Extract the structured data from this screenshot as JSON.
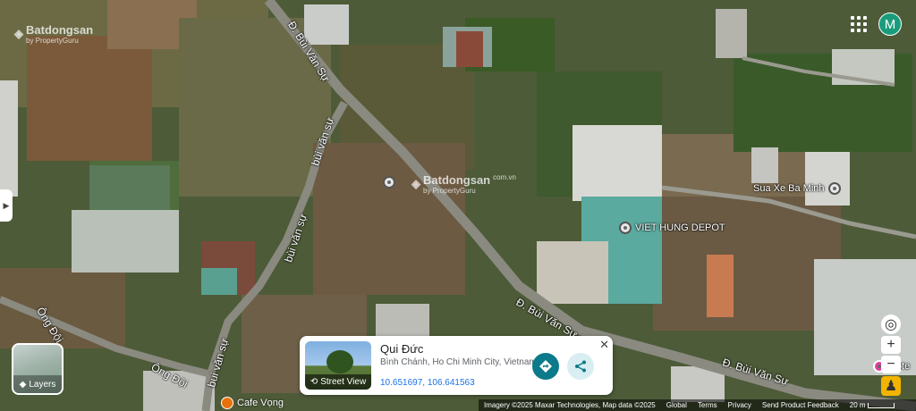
{
  "watermarks": [
    {
      "brand": "Batdongsan",
      "tagline": "by PropertyGuru",
      "domain": "com.vn"
    },
    {
      "brand": "Batdongsan",
      "tagline": "by PropertyGuru",
      "domain": "com.vn"
    }
  ],
  "roads": {
    "bui_van_su_1": "Đ. Bùi Văn Sự",
    "bui_van_su_2": "bùi văn sự",
    "bui_van_su_3": "bùi văn sự",
    "bui_van_su_4": "bui văn sự",
    "bui_van_su_5": "Đ. Bùi Văn Sự",
    "bui_van_su_6": "Đ. Bùi Văn Sự",
    "ong_doi_1": "Ông Đội",
    "ong_doi_2": "Ông Đội"
  },
  "places": {
    "sua_xe": "Sua Xe Ba Minh",
    "viet_hung": "VIET HUNG DEPOT",
    "cafe": "Cafe Vọng",
    "partial_right": "Hote"
  },
  "account": {
    "initial": "M",
    "color": "#1a9c7c"
  },
  "layers": {
    "label": "Layers"
  },
  "card": {
    "title": "Qui Đức",
    "address": "Bình Chánh, Ho Chi Minh City, Vietnam",
    "coordinates": "10.651697, 106.641563",
    "street_view_label": "Street View",
    "close": "✕",
    "directions_icon": "directions-icon",
    "share_icon": "share-icon",
    "accent_color": "#0b7a8a"
  },
  "controls": {
    "zoom_in": "+",
    "zoom_out": "−"
  },
  "footer": {
    "imagery": "Imagery ©2025 Maxar Technologies, Map data ©2025",
    "global": "Global",
    "terms": "Terms",
    "privacy": "Privacy",
    "feedback": "Send Product Feedback",
    "scale": "20 m"
  }
}
